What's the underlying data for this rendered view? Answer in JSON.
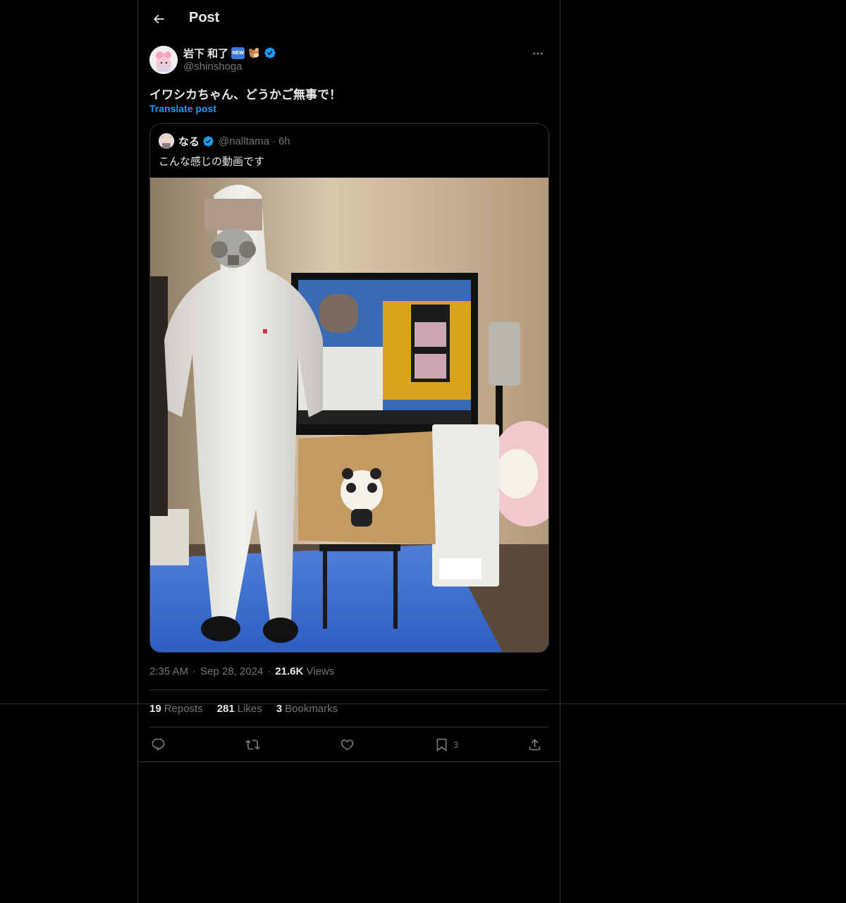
{
  "header": {
    "title": "Post"
  },
  "author": {
    "display_name": "岩下 和了",
    "new_badge": "NEW",
    "handle": "@shinshoga"
  },
  "post": {
    "text": "イワシカちゃん、どうかご無事で！",
    "translate_label": "Translate post",
    "time": "2:35 AM",
    "date": "Sep 28, 2024",
    "views_count": "21.6K",
    "views_label": "Views",
    "separator": "·"
  },
  "quote": {
    "display_name": "なる",
    "handle": "@nalltama",
    "time": "6h",
    "text": "こんな感じの動画です"
  },
  "stats": {
    "reposts_count": "19",
    "reposts_label": "Reposts",
    "likes_count": "281",
    "likes_label": "Likes",
    "bookmarks_count": "3",
    "bookmarks_label": "Bookmarks"
  },
  "actions": {
    "bookmark_count": "3"
  },
  "colors": {
    "background": "#000000",
    "border": "#2f3336",
    "text_primary": "#e7e9ea",
    "text_secondary": "#71767b",
    "accent": "#1d9bf0"
  },
  "icons": [
    "back-arrow-icon",
    "verified-icon",
    "more-icon",
    "reply-icon",
    "repost-icon",
    "like-icon",
    "bookmark-icon",
    "share-icon"
  ]
}
